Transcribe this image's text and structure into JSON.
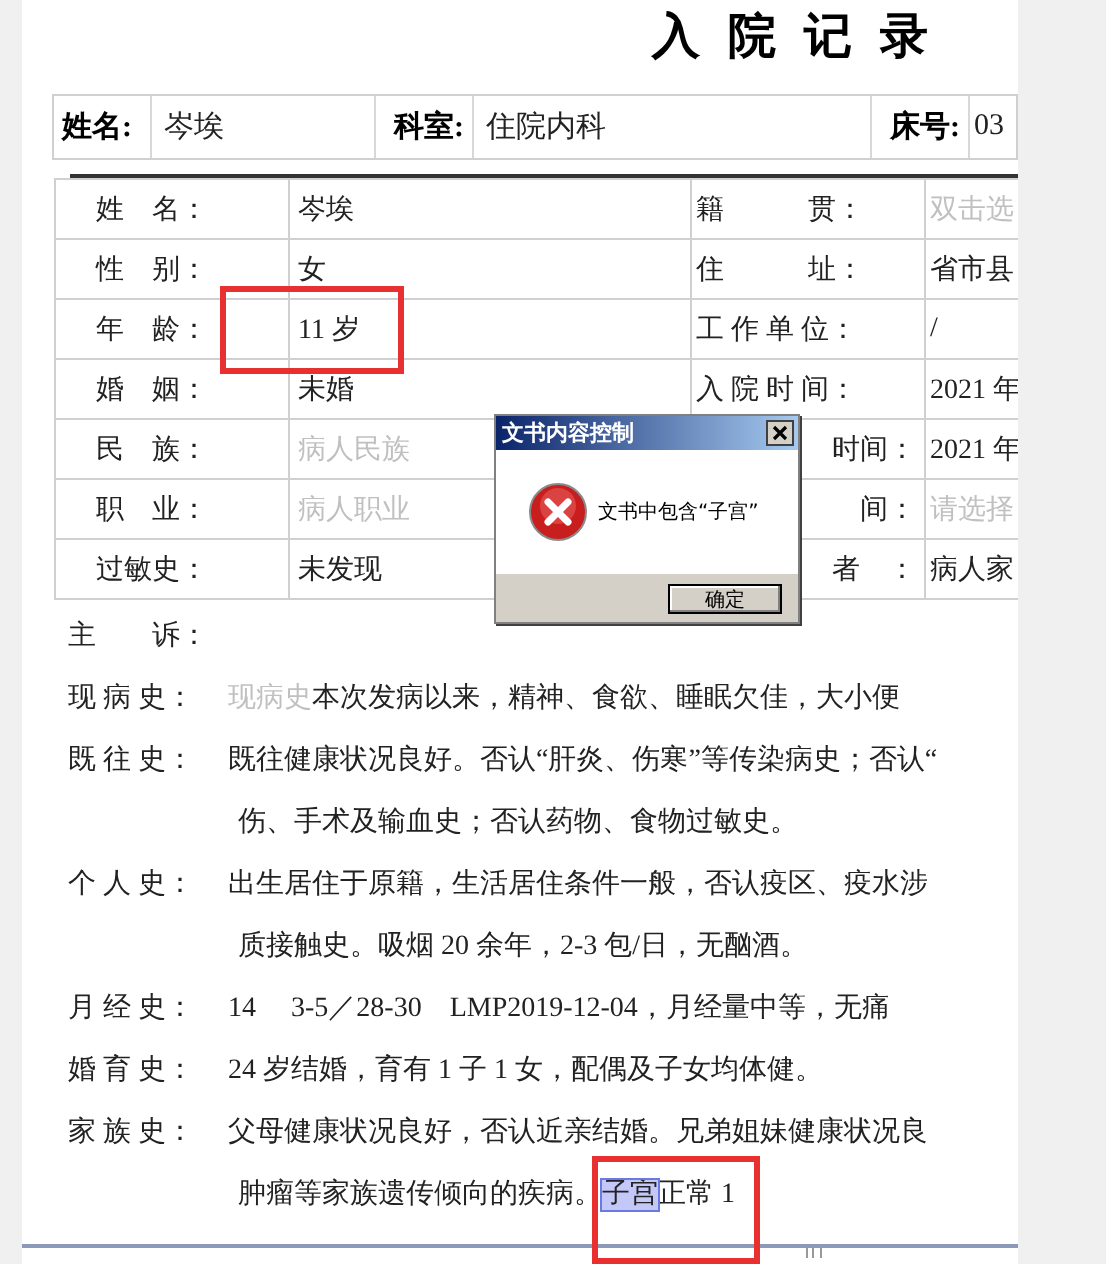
{
  "title": "入 院 记 录",
  "header": [
    {
      "label": "姓名:",
      "value": "岑埃"
    },
    {
      "label": "科室:",
      "value": "住院内科"
    },
    {
      "label": "床号:",
      "value": "03"
    }
  ],
  "info_rows": [
    {
      "left_label": "姓　名：",
      "left_value": "岑埃",
      "left_empty": false,
      "right_label": "籍　　　贯：",
      "right_value": "双击选",
      "right_empty": true
    },
    {
      "left_label": "性　别：",
      "left_value": "女",
      "left_empty": false,
      "right_label": "住　　　址：",
      "right_value": "省市县",
      "right_empty": false
    },
    {
      "left_label": "年　龄：",
      "left_value": "11 岁",
      "left_empty": false,
      "right_label": "工 作 单 位：",
      "right_value": "/",
      "right_empty": false
    },
    {
      "left_label": "婚　姻：",
      "left_value": "未婚",
      "left_empty": false,
      "right_label": "入 院 时 间：",
      "right_value": "2021 年",
      "right_empty": false
    },
    {
      "left_label": "民　族：",
      "left_value": "病人民族",
      "left_empty": true,
      "right_label": "时间：",
      "right_value": "2021 年",
      "right_empty": false
    },
    {
      "left_label": "职　业：",
      "left_value": "病人职业",
      "left_empty": true,
      "right_label": "间：",
      "right_value": "请选择",
      "right_empty": true
    },
    {
      "left_label": "过敏史：",
      "left_value": "未发现",
      "left_empty": false,
      "right_label": "者　：",
      "right_value": "病人家",
      "right_empty": false
    }
  ],
  "history": [
    {
      "label": "主　　诉："
    },
    {
      "label": "现 病 史：",
      "lines": [
        [
          {
            "kind": "hint",
            "text": "现病史"
          },
          {
            "kind": "normal",
            "text": "本次发病以来，精神、食欲、睡眠欠佳，大小便"
          }
        ]
      ]
    },
    {
      "label": "既 往 史：",
      "lines": [
        [
          {
            "kind": "normal",
            "text": "既往健康状况良好。否认“肝炎、伤寒”等传染病史；否认“"
          }
        ],
        [
          {
            "kind": "normal",
            "text": "伤、手术及输血史；否认药物、食物过敏史。"
          }
        ]
      ]
    },
    {
      "label": "个 人 史：",
      "lines": [
        [
          {
            "kind": "normal",
            "text": "出生居住于原籍，生活居住条件一般，否认疫区、疫水涉"
          }
        ],
        [
          {
            "kind": "normal",
            "text": "质接触史。吸烟 20 余年，2-3 包/日，无酗酒。"
          }
        ]
      ]
    },
    {
      "label": "月 经 史：",
      "lines": [
        [
          {
            "kind": "normal",
            "text": "14　 3-5／28-30　LMP2019-12-04，月经量中等，无痛"
          }
        ]
      ]
    },
    {
      "label": "婚 育 史：",
      "lines": [
        [
          {
            "kind": "normal",
            "text": "24 岁结婚，育有 1 子 1 女，配偶及子女均体健。"
          }
        ]
      ]
    },
    {
      "label": "家 族 史：",
      "lines": [
        [
          {
            "kind": "normal",
            "text": "父母健康状况良好，否认近亲结婚。兄弟姐妹健康状况良"
          }
        ],
        [
          {
            "kind": "normal",
            "text": "肿瘤等家族遗传倾向的疾病。"
          },
          {
            "kind": "selected",
            "text": "子宫"
          },
          {
            "kind": "normal",
            "text": "正常 1"
          }
        ]
      ]
    }
  ],
  "dialog": {
    "title": "文书内容控制",
    "message": "文书中包含“子宫”",
    "button": "确定"
  }
}
